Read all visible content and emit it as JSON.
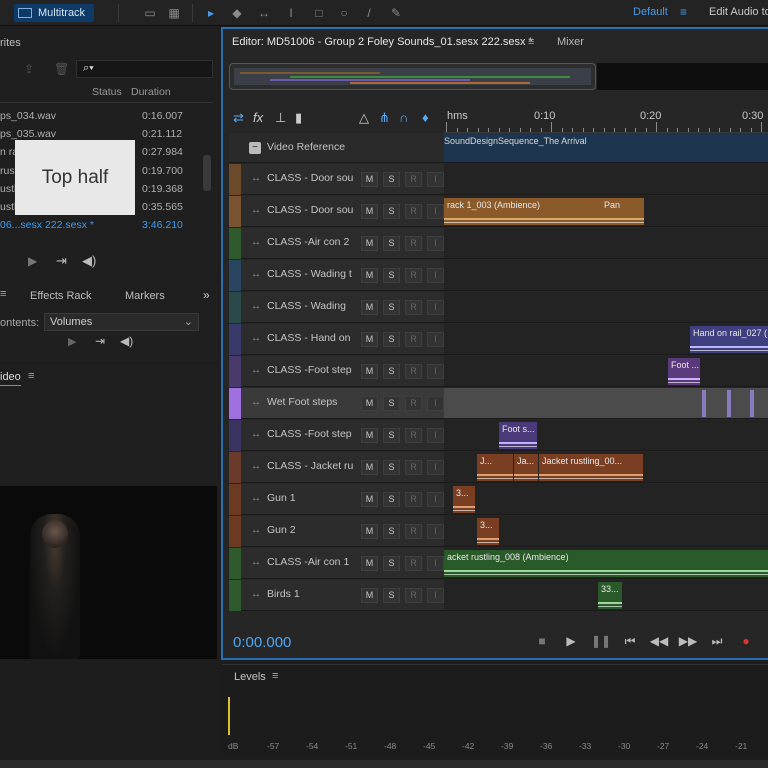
{
  "toolbar": {
    "mode_label": "Multitrack",
    "workspace": "Default",
    "workspace_menu": "≡",
    "edit_audio_label": "Edit Audio to"
  },
  "files_panel": {
    "title": "rites",
    "columns": {
      "status": "Status",
      "duration": "Duration"
    },
    "search_icon": "⌕▾",
    "rows": [
      {
        "name": "ps_034.wav",
        "duration": "0:16.007"
      },
      {
        "name": "ps_035.wav",
        "duration": "0:21.112"
      },
      {
        "name": "n rail_027.wav",
        "duration": "0:27.984"
      },
      {
        "name": "rustling_...",
        "duration": "0:19.700"
      },
      {
        "name": "ustling_004.wav",
        "duration": "0:19.368"
      },
      {
        "name": "ustling_008.wav",
        "duration": "0:35.565"
      },
      {
        "name": "06...sesx 222.sesx *",
        "duration": "3:46.210",
        "active": true
      }
    ]
  },
  "effects_panel": {
    "tab_effects": "Effects Rack",
    "tab_markers": "Markers",
    "contents_label": "ontents:",
    "contents_value": "Volumes"
  },
  "video_panel": {
    "title": "ideo"
  },
  "overlay_label": "Top half",
  "editor": {
    "title": "Editor: MD51006 - Group 2 Foley Sounds_01.sesx 222.sesx *",
    "mixer": "Mixer",
    "ruler": [
      {
        "label": "hms"
      },
      {
        "label": "0:10"
      },
      {
        "label": "0:20"
      },
      {
        "label": "0:30"
      }
    ],
    "video_reference": "Video Reference",
    "video_clip": "SoundDesignSequence_The Arrival",
    "mute": "M",
    "solo": "S",
    "record": "R",
    "input": "I",
    "tracks": [
      {
        "name": "CLASS - Door sou",
        "color": "#6a4a2a"
      },
      {
        "name": "CLASS - Door sou",
        "color": "#7a5330"
      },
      {
        "name": "CLASS -Air con 2",
        "color": "#2e5a2e"
      },
      {
        "name": "CLASS - Wading t",
        "color": "#2a4560"
      },
      {
        "name": "CLASS - Wading",
        "color": "#2a4a4a"
      },
      {
        "name": "CLASS - Hand on",
        "color": "#3a3a6a"
      },
      {
        "name": "CLASS -Foot step",
        "color": "#4a3a6a"
      },
      {
        "name": "Wet Foot steps",
        "color": "#a070e0",
        "selected": true
      },
      {
        "name": "CLASS -Foot step",
        "color": "#3a3560"
      },
      {
        "name": "CLASS - Jacket ru",
        "color": "#6a3a2a"
      },
      {
        "name": "Gun 1",
        "color": "#6a3a22"
      },
      {
        "name": "Gun 2",
        "color": "#6a3a22"
      },
      {
        "name": "CLASS -Air con 1",
        "color": "#2e5a2e"
      },
      {
        "name": "Birds 1",
        "color": "#2e5a2e"
      }
    ],
    "clips": {
      "door2": "rack 1_003 (Ambience)",
      "door2_pan": "Pan",
      "hand": "Hand on rail_027 (",
      "foot1": "Foot ...",
      "foot2": "Foot s...",
      "jacket_a": "J...",
      "jacket_b": "Ja...",
      "jacket_c": "Jacket rustling_00...",
      "gun1": "3...",
      "gun2": "3...",
      "aircon1": "acket rustling_008 (Ambience)",
      "birds": "33..."
    }
  },
  "transport": {
    "timecode": "0:00.000"
  },
  "levels": {
    "title": "Levels",
    "menu": "≡",
    "scale": [
      "dB",
      "-57",
      "-54",
      "-51",
      "-48",
      "-45",
      "-42",
      "-39",
      "-36",
      "-33",
      "-30",
      "-27",
      "-24",
      "-21"
    ]
  }
}
